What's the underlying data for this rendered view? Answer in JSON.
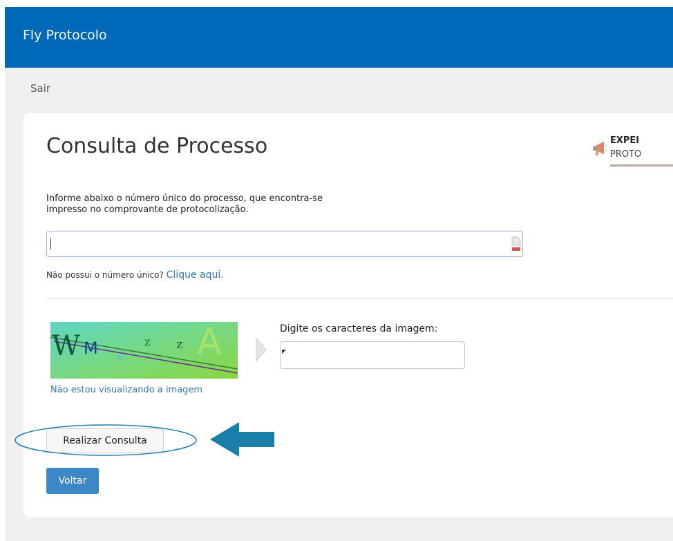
{
  "header": {
    "brand": "Fly Protocolo"
  },
  "nav": {
    "logout_label": "Sair"
  },
  "page": {
    "title": "Consulta de Processo",
    "instructions_line1": "Informe abaixo o número único do processo, que encontra-se",
    "instructions_line2": "impresso no comprovante de protocolização."
  },
  "promo": {
    "title": "EXPEI",
    "subtitle": "PROTO"
  },
  "process_input": {
    "value": "",
    "placeholder": ""
  },
  "no_number": {
    "prompt": "Não possui o número único?",
    "link_label": "Clique aqui."
  },
  "captcha": {
    "label": "Digite os caracteres da imagem:",
    "value": "",
    "cant_see_link": "Não estou visualizando a imagem",
    "glyphs": [
      "W",
      "M",
      "x",
      "z",
      "z",
      "A"
    ]
  },
  "buttons": {
    "submit_label": "Realizar Consulta",
    "back_label": "Voltar"
  },
  "colors": {
    "header": "#0068b8",
    "link": "#2f7ab8",
    "primary_button": "#3c87c6",
    "annotation": "#1a7fa8"
  },
  "icons": [
    "megaphone-icon",
    "input-addon-icon",
    "chevron-right-icon",
    "left-arrow-icon"
  ]
}
